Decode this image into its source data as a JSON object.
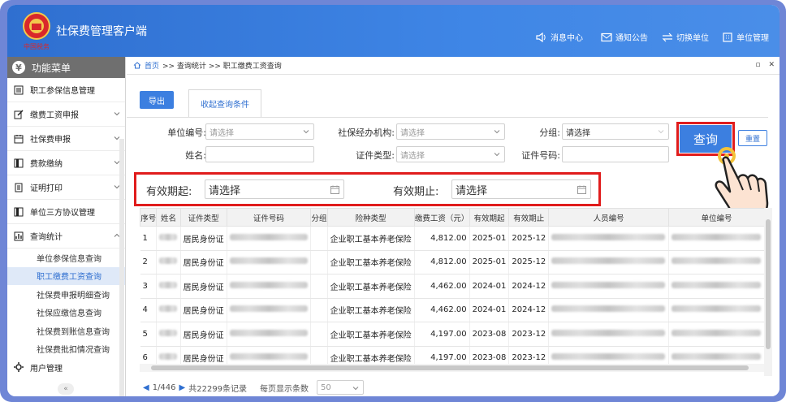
{
  "app": {
    "title": "社保费管理客户端",
    "logo_text": "中国税务"
  },
  "topnav": [
    {
      "label": "消息中心",
      "icon": "speaker-icon"
    },
    {
      "label": "通知公告",
      "icon": "mail-icon"
    },
    {
      "label": "切换单位",
      "icon": "swap-icon"
    },
    {
      "label": "单位管理",
      "icon": "building-icon"
    }
  ],
  "sidebar": {
    "header": "功能菜单",
    "items": [
      {
        "label": "职工参保信息管理",
        "chev": false
      },
      {
        "label": "缴费工资申报",
        "chev": true
      },
      {
        "label": "社保费申报",
        "chev": true
      },
      {
        "label": "费款缴纳",
        "chev": true
      },
      {
        "label": "证明打印",
        "chev": true
      },
      {
        "label": "单位三方协议管理",
        "chev": false
      },
      {
        "label": "查询统计",
        "chev": true
      }
    ],
    "sub_items": [
      "单位参保信息查询",
      "职工缴费工资查询",
      "社保费申报明细查询",
      "社保应缴信息查询",
      "社保费到账信息查询",
      "社保费批扣情况查询"
    ],
    "last_item": "用户管理"
  },
  "breadcrumb": {
    "home": "首页",
    "path": ">> 查询统计 >> 职工缴费工资查询"
  },
  "toolbar": {
    "export": "导出",
    "collapse": "收起查询条件"
  },
  "form": {
    "unit_code_label": "单位编号:",
    "unit_code_ph": "请选择",
    "agency_label": "社保经办机构:",
    "agency_ph": "请选择",
    "group_label": "分组:",
    "group_ph": "请选择",
    "name_label": "姓名:",
    "idtype_label": "证件类型:",
    "idtype_ph": "请选择",
    "idno_label": "证件号码:",
    "start_label": "有效期起:",
    "start_ph": "请选择",
    "end_label": "有效期止:",
    "end_ph": "请选择",
    "query": "查询",
    "reset": "重置"
  },
  "table": {
    "headers": [
      "序号",
      "姓名",
      "证件类型",
      "证件号码",
      "分组",
      "险种类型",
      "缴费工资（元）",
      "有效期起",
      "有效期止",
      "人员编号",
      "单位编号"
    ],
    "rows": [
      {
        "no": "1",
        "idtype": "居民身份证",
        "insurance": "企业职工基本养老保险",
        "wage": "4,812.00",
        "start": "2025-01",
        "end": "2025-12"
      },
      {
        "no": "2",
        "idtype": "居民身份证",
        "insurance": "企业职工基本养老保险",
        "wage": "4,812.00",
        "start": "2025-01",
        "end": "2025-12"
      },
      {
        "no": "3",
        "idtype": "居民身份证",
        "insurance": "企业职工基本养老保险",
        "wage": "4,462.00",
        "start": "2024-01",
        "end": "2024-12"
      },
      {
        "no": "4",
        "idtype": "居民身份证",
        "insurance": "企业职工基本养老保险",
        "wage": "4,462.00",
        "start": "2024-01",
        "end": "2024-12"
      },
      {
        "no": "5",
        "idtype": "居民身份证",
        "insurance": "企业职工基本养老保险",
        "wage": "4,197.00",
        "start": "2023-08",
        "end": "2023-12"
      },
      {
        "no": "6",
        "idtype": "居民身份证",
        "insurance": "企业职工基本养老保险",
        "wage": "4,197.00",
        "start": "2023-08",
        "end": "2023-12"
      }
    ]
  },
  "pager": {
    "page": "1/446",
    "total": "共22299条记录",
    "size_label": "每页显示条数",
    "size": "50"
  },
  "colors": {
    "primary": "#3c7fe0",
    "highlight": "#e01c1c",
    "topbar": "#3f86e6"
  }
}
